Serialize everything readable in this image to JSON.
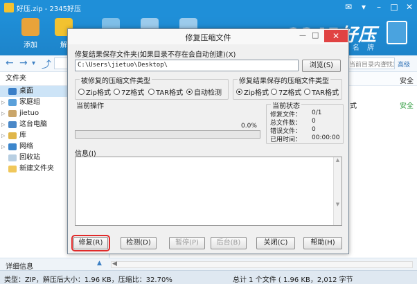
{
  "app": {
    "title": "好压.zip - 2345好压",
    "brand": "2345好压",
    "brand_sub": "名 牌"
  },
  "toolbar": {
    "add_label": "添加",
    "second_label": "解"
  },
  "addressbar": {
    "search_placeholder": "当前目录内查找)",
    "advanced_label": "高级"
  },
  "sidebar": {
    "header": "文件夹",
    "items": [
      {
        "label": "桌面",
        "icon": "desktop-icon",
        "selected": true
      },
      {
        "label": "家庭组",
        "icon": "homegroup-icon"
      },
      {
        "label": "jietuo",
        "icon": "user-folder-icon"
      },
      {
        "label": "这台电脑",
        "icon": "computer-icon"
      },
      {
        "label": "库",
        "icon": "library-icon"
      },
      {
        "label": "网络",
        "icon": "network-icon"
      },
      {
        "label": "回收站",
        "icon": "recycle-bin-icon"
      },
      {
        "label": "新建文件夹",
        "icon": "folder-icon"
      }
    ]
  },
  "content": {
    "col_safe": "安全",
    "row_format": "式",
    "row_safe": "安全"
  },
  "detailbar": {
    "label": "详细信息"
  },
  "statusbar": {
    "left": "类型：ZIP，解压后大小：1.96 KB，压缩比：32.70%",
    "right": "总计 1 个文件 ( 1.96 KB，2,012 字节"
  },
  "dialog": {
    "title": "修复压缩文件",
    "save_folder_label": "修复结果保存文件夹(如果目录不存在会自动创建)(X)",
    "path_value": "C:\\Users\\jietuo\\Desktop\\",
    "browse_label": "浏览(S)",
    "source_type_group": "被修复的压缩文件类型",
    "source_types": [
      "Zip格式",
      "7Z格式",
      "TAR格式",
      "自动检测"
    ],
    "source_selected_index": 3,
    "result_type_group": "修复结果保存的压缩文件类型",
    "result_types": [
      "Zip格式",
      "7Z格式",
      "TAR格式"
    ],
    "result_selected_index": 0,
    "current_op_group": "当前操作",
    "progress_percent": 0,
    "progress_text": "0.0%",
    "current_status_group": "当前状态",
    "status_rows": [
      {
        "label": "修复文件：",
        "value": "0/1"
      },
      {
        "label": "总文件数：",
        "value": "0"
      },
      {
        "label": "错误文件：",
        "value": "0"
      },
      {
        "label": "已用时间：",
        "value": "00:00:00"
      }
    ],
    "info_label": "信息(I)",
    "buttons": {
      "repair": "修复(R)",
      "check": "检测(D)",
      "pause": "暂停(P)",
      "background": "后台(B)",
      "close": "关闭(C)",
      "help": "帮助(H)"
    }
  },
  "colors": {
    "accent": "#1f8fd8",
    "close_red": "#e04343",
    "highlight_red": "#e02a2a",
    "safe_green": "#2a9a3a"
  }
}
